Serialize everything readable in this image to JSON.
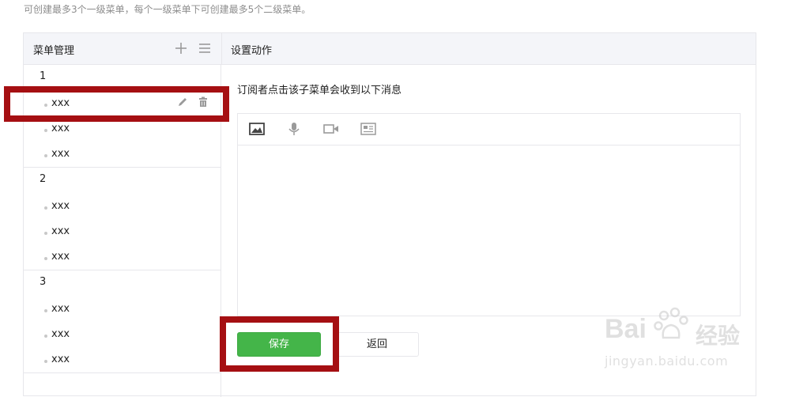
{
  "notice": "可创建最多3个一级菜单，每个一级菜单下可创建最多5个二级菜单。",
  "left_panel": {
    "title": "菜单管理",
    "add_icon": "plus-icon",
    "sort_icon": "list-icon",
    "groups": [
      {
        "label": "1",
        "items": [
          "xxx",
          "xxx",
          "xxx"
        ]
      },
      {
        "label": "2",
        "items": [
          "xxx",
          "xxx",
          "xxx"
        ]
      },
      {
        "label": "3",
        "items": [
          "xxx",
          "xxx",
          "xxx"
        ]
      }
    ],
    "item_actions": [
      "pencil-icon",
      "trash-icon"
    ]
  },
  "right_panel": {
    "title": "设置动作",
    "prompt": "订阅者点击该子菜单会收到以下消息",
    "toolbar": [
      "image-icon",
      "microphone-icon",
      "video-icon",
      "article-icon"
    ]
  },
  "buttons": {
    "save": "保存",
    "back": "返回"
  },
  "watermark": {
    "brand": "Bai",
    "brand2": "经验",
    "url": "jingyan.baidu.com"
  },
  "colors": {
    "save_green": "#44b549",
    "highlight_red": "#a50f12",
    "header_bg": "#f4f5f9",
    "border": "#e7e7eb"
  }
}
